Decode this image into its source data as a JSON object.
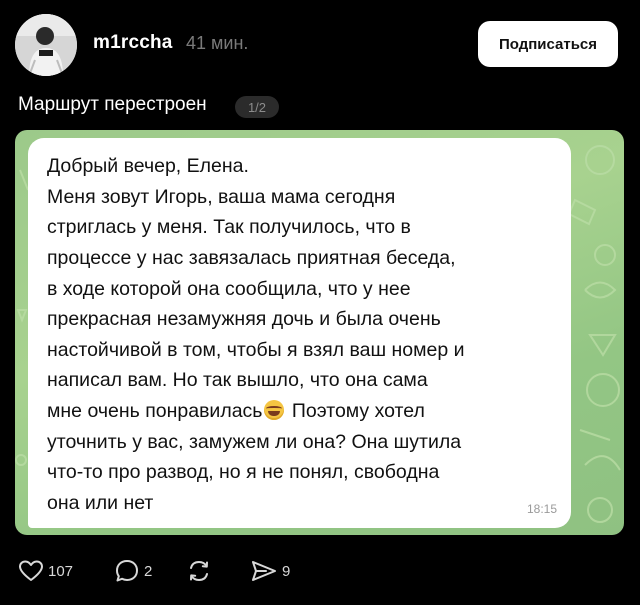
{
  "header": {
    "username": "m1rccha",
    "time": "41 мин.",
    "subscribe_label": "Подписаться"
  },
  "post": {
    "title": "Маршрут перестроен",
    "image_counter": "1/2"
  },
  "message": {
    "lines": [
      "Добрый вечер, Елена.",
      "Меня зовут Игорь, ваша мама сегодня",
      "стриглась у меня. Так получилось, что в",
      "процессе у  нас завязалась приятная беседа,",
      "в ходе которой она сообщила, что у нее",
      "прекрасная незамужняя дочь и была очень",
      "настойчивой в том, чтобы я взял ваш номер и",
      "написал вам. Но так вышло, что она сама",
      "мне очень понравилась",
      " Поэтому хотел",
      "уточнить у вас, замужем ли она? Она шутила",
      "что-то про развод, но я не понял, свободна",
      "она или нет"
    ],
    "time": "18:15"
  },
  "actions": {
    "likes": "107",
    "comments": "2",
    "reposts": "",
    "shares": "9"
  },
  "colors": {
    "background": "#000000",
    "chat_background": "#a3cf8c",
    "bubble": "#ffffff",
    "muted_text": "#7a7a7a"
  },
  "icons": {
    "like": "heart-outline-icon",
    "comment": "speech-bubble-icon",
    "repost": "repost-arrows-icon",
    "share": "paper-plane-icon"
  }
}
